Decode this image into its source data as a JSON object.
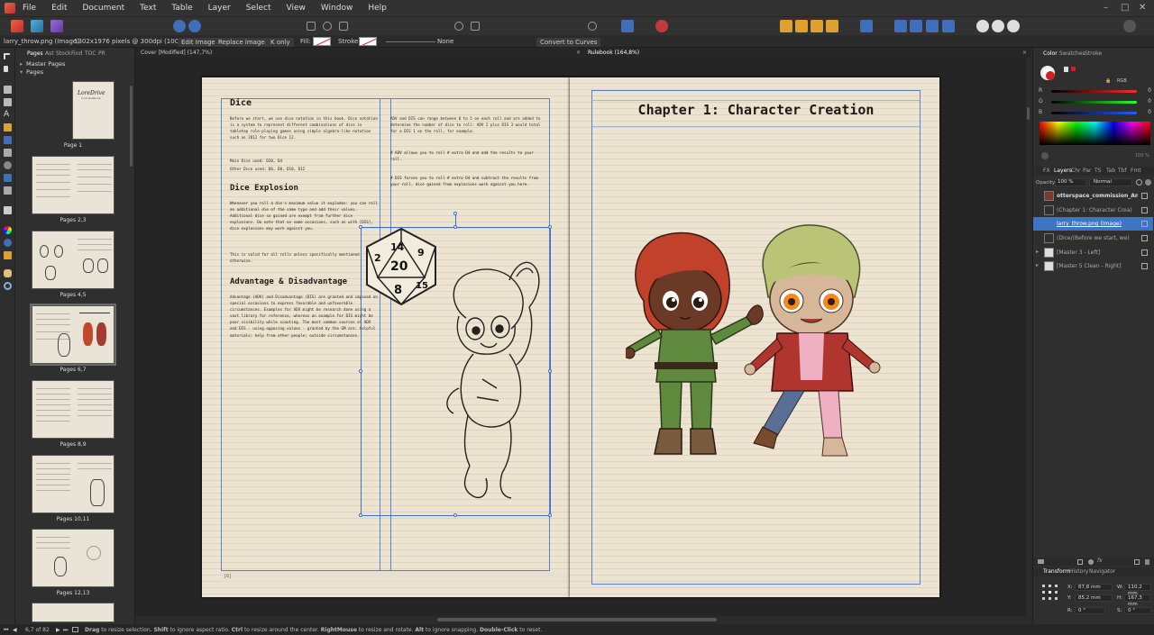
{
  "menu": [
    "File",
    "Edit",
    "Document",
    "Text",
    "Table",
    "Layer",
    "Select",
    "View",
    "Window",
    "Help"
  ],
  "context_bar": {
    "selection": "larry_throw.png (Image)",
    "info": "1302x1976 pixels @ 300dpi (100%)",
    "edit_image": "Edit Image",
    "replace_image": "Replace image",
    "k_only": "K only",
    "fill_label": "Fill:",
    "stroke_label": "Stroke:",
    "stroke_none": "None",
    "convert_to_curves": "Convert to Curves"
  },
  "pages_panel": {
    "tabs": [
      "Pages",
      "Ast",
      "Stock",
      "Find",
      "TOC",
      "PR"
    ],
    "master_pages": "Master Pages",
    "pages": "Pages",
    "thumbs": [
      {
        "label": "Page 1"
      },
      {
        "label": "Pages 2,3"
      },
      {
        "label": "Pages 4,5"
      },
      {
        "label": "Pages 6,7"
      },
      {
        "label": "Pages 8,9"
      },
      {
        "label": "Pages 10,11"
      },
      {
        "label": "Pages 12,13"
      }
    ],
    "cover_title": "LoreDrive",
    "cover_subtitle": "Core Rulebook"
  },
  "doc_tabs": [
    "Cover [Modified] (147,7%)",
    "Rulebook (164,8%)"
  ],
  "left_page": {
    "dice_heading": "Dice",
    "dice_text": "Before we start, we use dice notation in this book. Dice notation is a system to represent different combinations of dice in tabletop role-playing games using simple algebra-like notation such as 2D12 for two Dice 12.",
    "main_dice": "Main Dice used: D20, D4",
    "other_dice": "Other Dice used: D6, D8, D10, D12",
    "explosion_heading": "Dice Explosion",
    "explosion_text": "Whenever you roll a die's maximum value it explodes: you can roll an additional die of the same type and add their values. Additional dice so gained are exempt from further dice explosions. Do note that on some occasions, such as with [DIS], dice explosions may work against you.",
    "explosion_note": "This is valid for all rolls unless specifically mentioned otherwise.",
    "advdis_heading": "Advantage & Disadvantage",
    "advdis_text": "Advantage (ADV) and Disadvantage (DIS) are granted and imposed on special occasions to express favorable and unfavorable circumstances. Examples for ADV might be research done using a vast library for reference, whereas an example for DIS might be poor visibility while scouting. The most common sources of ADV and DIS - using opposing values - granted by the GM are: helpful materials; help from other people; outside circumstances.",
    "col2_p1": "ADV and DIS can range between 0 to 5 on each roll and are added to determine the number of dice to roll: ADV 2 plus DIS 3 would total for a DIS 1 on the roll, for example.",
    "col2_p2": "# ADV allows you to roll # extra D4 and add the results to your roll.",
    "col2_p3": "# DIS forces you to roll # extra D4 and subtract the results from your roll, dice gained from explosions work against you here.",
    "page_number": "[6]",
    "d20_numbers": [
      "2",
      "14",
      "9",
      "20",
      "8",
      "15"
    ]
  },
  "right_page": {
    "chapter_title": "Chapter 1: Character Creation"
  },
  "right_panel": {
    "top_tabs": [
      "Color",
      "Swatches",
      "Stroke"
    ],
    "color_mode": "RGB",
    "sliders": [
      {
        "label": "R",
        "value": "0",
        "color": "#d83a3a"
      },
      {
        "label": "G",
        "value": "0",
        "color": "#3ab83a"
      },
      {
        "label": "B",
        "value": "0",
        "color": "#3a6ad8"
      }
    ],
    "opacity_readout": "100 %",
    "layer_tabs": [
      "FX",
      "Layers",
      "Chr",
      "Par",
      "TS",
      "Tab",
      "Tbf",
      "Fmt"
    ],
    "opacity_label": "Opacity:",
    "opacity_value": "100 %",
    "blend_mode": "Normal",
    "layers": [
      {
        "name": "otterspace_commission_Ana...",
        "selected": false
      },
      {
        "name": "(Chapter 1: Character Crea)",
        "selected": false
      },
      {
        "name": "larry_throw.png (Image)",
        "selected": true
      },
      {
        "name": "(Dice/(Before we start, we)",
        "selected": false
      },
      {
        "name": "[Master 3 - Left]",
        "selected": false
      },
      {
        "name": "[Master 5 Clean - Right]",
        "selected": false
      }
    ],
    "transform_tabs": [
      "Transform",
      "History",
      "Navigator"
    ],
    "transform": {
      "x_label": "X:",
      "x": "87,8 mm",
      "y_label": "Y:",
      "y": "85,2 mm",
      "w_label": "W:",
      "w": "110,2 mm",
      "h_label": "H:",
      "h": "167,3 mm",
      "r_label": "R:",
      "r": "0 °",
      "s_label": "S:",
      "s": "0 °"
    }
  },
  "status": {
    "page": "6,7 of 82",
    "hint_drag": "Drag",
    "hint_1": " to resize selection. ",
    "hint_shift": "Shift",
    "hint_2": " to ignore aspect ratio. ",
    "hint_ctrl": "Ctrl",
    "hint_3": " to resize around the center. ",
    "hint_rmouse": "RightMouse",
    "hint_4": " to resize and rotate. ",
    "hint_alt": "Alt",
    "hint_5": " to ignore snapping. ",
    "hint_dbl": "Double-Click",
    "hint_6": " to reset."
  },
  "colors": {
    "accent": "#3d74c4",
    "page": "#ece4d0",
    "guide": "#5a7fd0"
  }
}
